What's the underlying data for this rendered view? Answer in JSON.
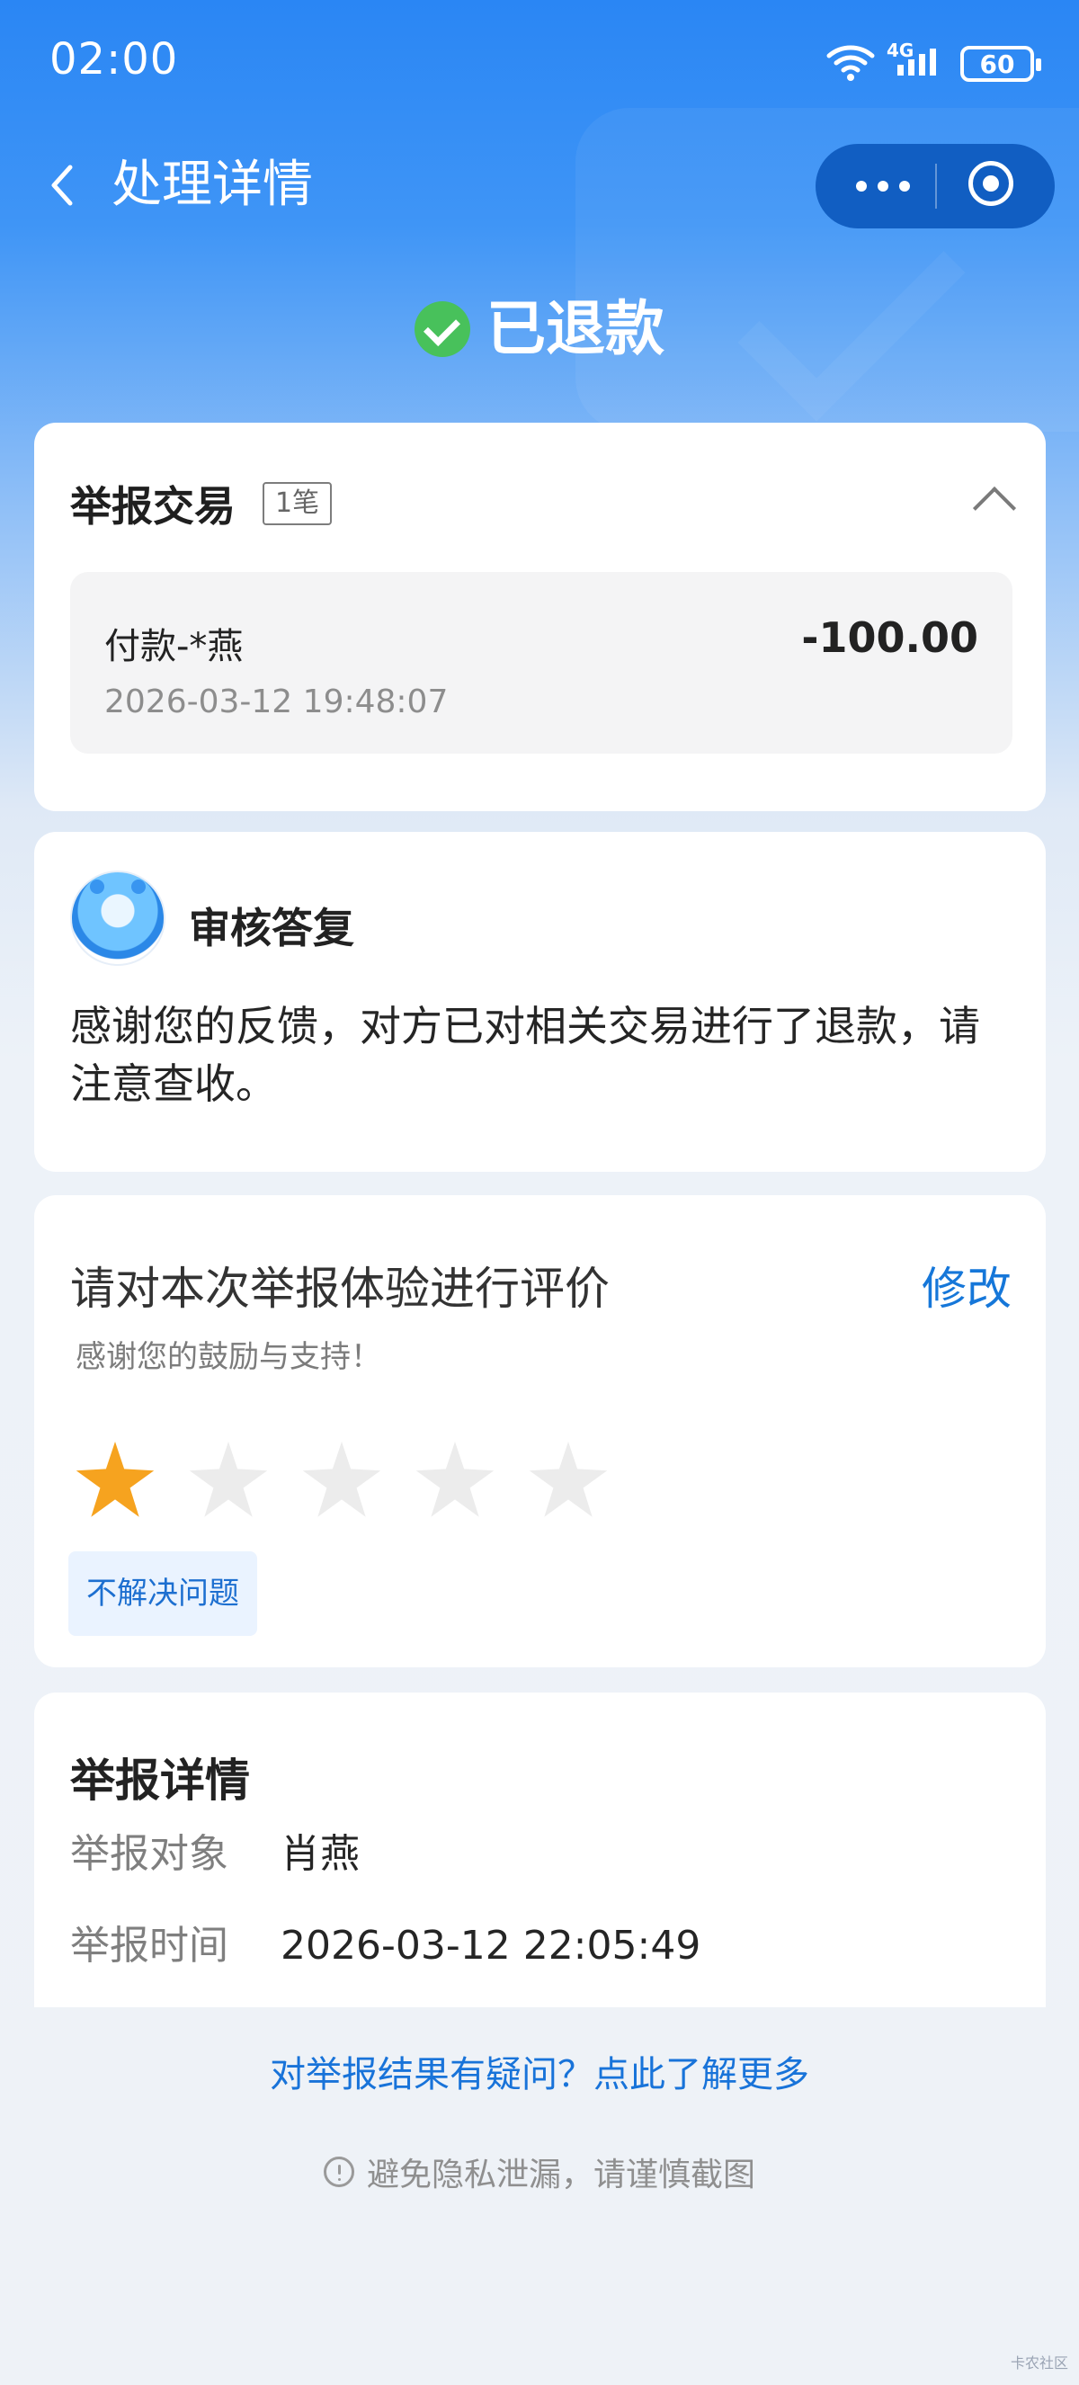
{
  "status_bar": {
    "time": "02:00",
    "network": "4G",
    "battery": "60"
  },
  "topbar": {
    "title": "处理详情"
  },
  "status": {
    "title": "已退款"
  },
  "report": {
    "title": "举报交易",
    "count": "1笔",
    "transaction": {
      "name": "付款-*燕",
      "amount": "-100.00",
      "time": "2026-03-12 19:48:07"
    }
  },
  "reply": {
    "title": "审核答复",
    "text": "感谢您的反馈，对方已对相关交易进行了退款，请注意查收。"
  },
  "rating": {
    "title": "请对本次举报体验进行评价",
    "subtitle": "感谢您的鼓励与支持！",
    "edit": "修改",
    "score": 1,
    "max": 5,
    "tag": "不解决问题"
  },
  "detail": {
    "title": "举报详情",
    "rows": [
      {
        "label": "举报对象",
        "value": "肖燕"
      },
      {
        "label": "举报时间",
        "value": "2026-03-12 22:05:49"
      }
    ]
  },
  "footer": {
    "help_link": "对举报结果有疑问？点此了解更多",
    "privacy_notice": "避免隐私泄漏，请谨慎截图"
  },
  "watermark": "卡农社区",
  "colors": {
    "primary_blue": "#2a86f4",
    "success_green": "#48c15b",
    "star_orange": "#f6a31f",
    "link_blue": "#1873d9"
  },
  "icons": {
    "back": "back-icon",
    "more": "more-icon",
    "close_app": "circle-icon",
    "check": "check-icon",
    "collapse": "chevron-up-icon",
    "info": "info-icon"
  }
}
